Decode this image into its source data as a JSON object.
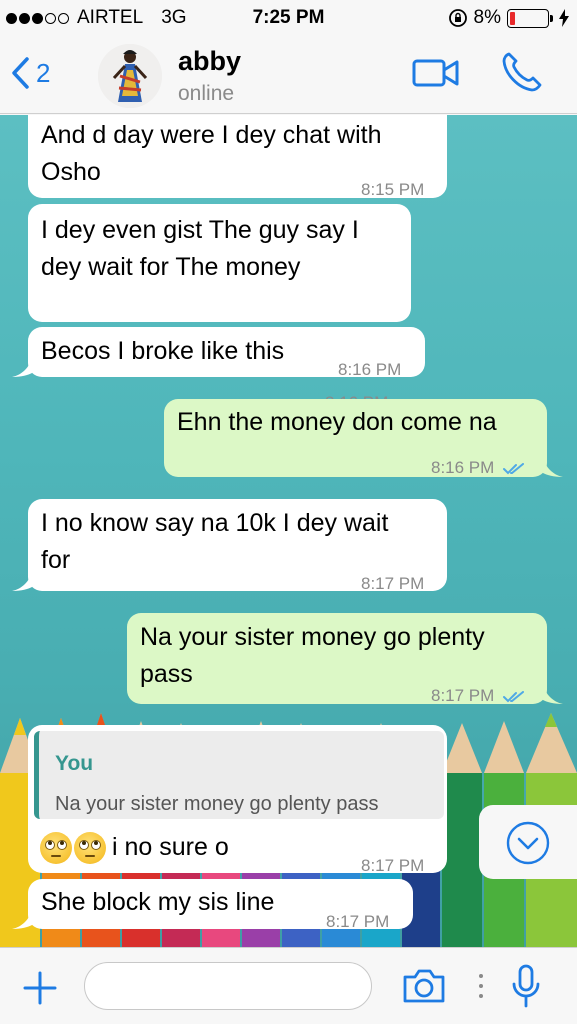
{
  "status_bar": {
    "carrier": "AIRTEL",
    "network": "3G",
    "time": "7:25 PM",
    "battery": "8%"
  },
  "header": {
    "back_count": "2",
    "contact_name": "abby",
    "contact_status": "online"
  },
  "messages": [
    {
      "direction": "in",
      "text_lines": [
        "And d day were I dey chat with",
        "Osho"
      ],
      "time": "8:15 PM"
    },
    {
      "direction": "in",
      "text_lines": [
        "I dey even gist The guy say I",
        "dey wait for The money"
      ],
      "time": "8:16 PM"
    },
    {
      "direction": "in",
      "text_lines": [
        "Becos I broke like this"
      ],
      "time": "8:16 PM"
    },
    {
      "direction": "out",
      "text_lines": [
        "Ehn the money don come na"
      ],
      "time": "8:16 PM",
      "read": true
    },
    {
      "direction": "in",
      "text_lines": [
        "I no know say na 10k I dey wait",
        "for"
      ],
      "time": "8:17 PM"
    },
    {
      "direction": "out",
      "text_lines": [
        "Na your sister money go plenty",
        "pass"
      ],
      "time": "8:17 PM",
      "read": true
    },
    {
      "direction": "in",
      "quote_author": "You",
      "quote_text": "Na your sister money go plenty pass",
      "text": "i no sure o",
      "emoji": [
        "face-with-rolling-eyes",
        "face-with-rolling-eyes"
      ],
      "time": "8:17 PM"
    },
    {
      "direction": "in",
      "text_lines": [
        "She block my sis line"
      ],
      "time": "8:17 PM"
    }
  ],
  "input": {
    "placeholder": "",
    "value": ""
  },
  "colors": {
    "accent": "#1e7be3",
    "incoming_bubble": "#ffffff",
    "outgoing_bubble": "#dcf8c6",
    "read_ticks": "#4fa9e6",
    "quote_accent": "#35968f",
    "chat_background": "#55bbbe"
  },
  "icons": {
    "back": "chevron-left-icon",
    "video": "video-camera-icon",
    "call": "phone-icon",
    "scroll_down": "chevron-down-circle-icon",
    "attach": "plus-icon",
    "camera": "camera-icon",
    "mic": "microphone-icon"
  }
}
